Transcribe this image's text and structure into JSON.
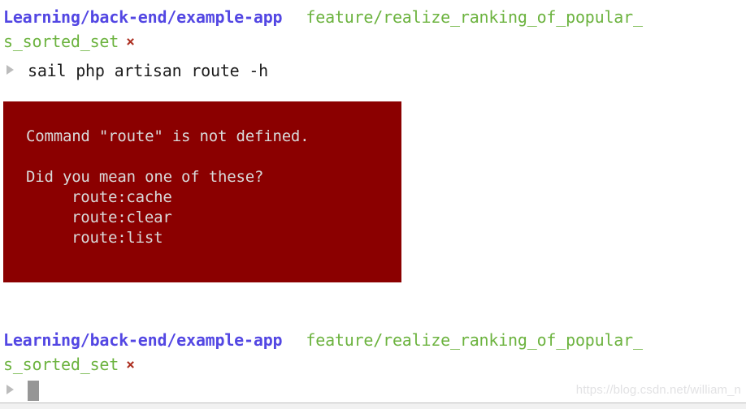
{
  "colors": {
    "path": "#5347e3",
    "branch": "#6cb33f",
    "close_mark": "#ad3022",
    "error_background": "#8b0000",
    "error_text": "#d9d9d9",
    "command_text": "#1d1d1d",
    "cursor": "#969696",
    "watermark": "#e2e2e4",
    "background": "#ffffff"
  },
  "prompt_top": {
    "path": "Learning/back-end/example-app",
    "branch": "feature/realize_ranking_of_popular_",
    "branch_wrapped": "s_sorted_set",
    "close_mark": "×"
  },
  "command": {
    "marker": "run-icon",
    "text": "sail php artisan route -h"
  },
  "error_output": {
    "lines": [
      "Command \"route\" is not defined.",
      "",
      "Did you mean one of these?"
    ],
    "suggestions": [
      "route:cache",
      "route:clear",
      "route:list"
    ]
  },
  "prompt_bottom": {
    "path": "Learning/back-end/example-app",
    "branch": "feature/realize_ranking_of_popular_",
    "branch_wrapped": "s_sorted_set",
    "close_mark": "×",
    "input_value": ""
  },
  "watermark": {
    "text": "https://blog.csdn.net/william_n"
  }
}
